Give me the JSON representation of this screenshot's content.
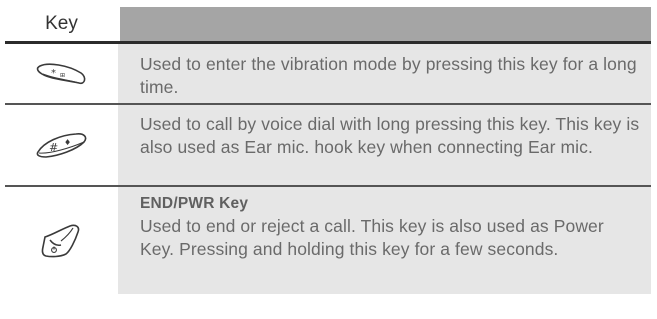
{
  "table": {
    "header_key": "Key",
    "rows": [
      {
        "icon": "star-vibration-key-icon",
        "title": "",
        "description": "Used to enter the vibration mode by pressing this key for a long time."
      },
      {
        "icon": "hash-voice-key-icon",
        "title": "",
        "description": "Used to call by voice dial with long pressing this key. This key is also used as Ear mic. hook key when connecting Ear mic."
      },
      {
        "icon": "end-power-key-icon",
        "title": "END/PWR Key",
        "description": "Used to end or reject a call. This key is also used as Power Key. Pressing and holding this key for a few seconds."
      }
    ]
  }
}
